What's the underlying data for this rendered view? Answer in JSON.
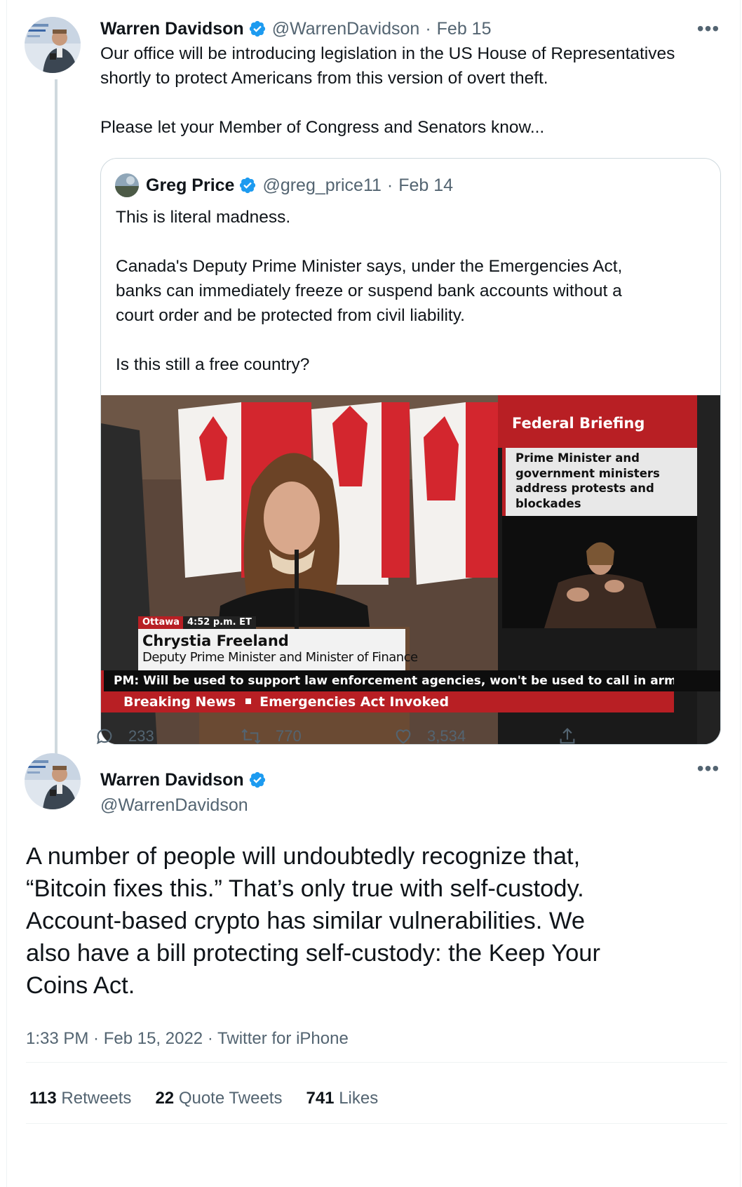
{
  "parent_tweet": {
    "author_name": "Warren Davidson",
    "author_handle": "@WarrenDavidson",
    "date": "Feb 15",
    "more": "•••",
    "paragraphs": [
      "Our office will be introducing legislation in the US House of Representatives",
      "shortly to protect Americans from this version of overt theft.",
      "Please let your Member of Congress and Senators know..."
    ]
  },
  "quoted_tweet": {
    "author_name": "Greg Price",
    "author_handle": "@greg_price11",
    "date": "Feb 14",
    "lines": [
      "This is literal madness.",
      "Canada's Deputy Prime Minister says, under the Emergencies Act,",
      "banks can immediately freeze or suspend bank accounts without a",
      "court order and be protected from civil liability.",
      "Is this still a free country?"
    ],
    "media": {
      "panel_title": "Federal Briefing",
      "panel_subtitle_lines": [
        "Prime Minister and",
        "government ministers",
        "address protests and",
        "blockades"
      ],
      "location": "Ottawa",
      "time": "4:52 p.m. ET",
      "speaker_name": "Chrystia Freeland",
      "speaker_title": "Deputy Prime Minister and Minister of Finance",
      "ticker": "PM: Will be used to support law enforcement agencies, won't be used to call in army",
      "breaking_label": "Breaking News",
      "breaking_headline": "Emergencies Act Invoked"
    }
  },
  "parent_actions": {
    "replies": "233",
    "retweets": "770",
    "likes": "3,534"
  },
  "main_tweet": {
    "author_name": "Warren Davidson",
    "author_handle": "@WarrenDavidson",
    "more": "•••",
    "text_lines": [
      "A number of people will undoubtedly recognize that,",
      "“Bitcoin fixes this.” That’s only true with self-custody.",
      "Account-based crypto has similar vulnerabilities. We",
      "also have a bill protecting self-custody: the Keep Your",
      "Coins Act."
    ],
    "meta": "1:33 PM · Feb 15, 2022 · Twitter for iPhone",
    "stats": {
      "retweets_count": "113",
      "retweets_label": "Retweets",
      "quotes_count": "22",
      "quotes_label": "Quote Tweets",
      "likes_count": "741",
      "likes_label": "Likes"
    }
  },
  "colors": {
    "verified": "#1d9bf0",
    "secondary_text": "#536471",
    "broadcast_red": "#b81f24"
  }
}
